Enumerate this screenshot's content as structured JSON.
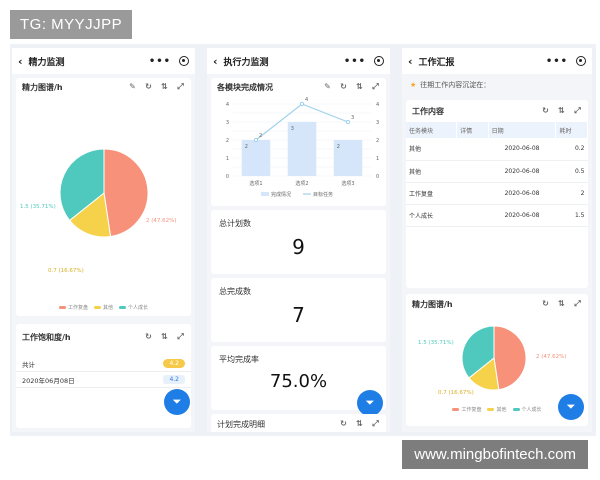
{
  "tg_badge": "TG: MYYJJPP",
  "watermark": "www.mingbofintech.com",
  "colors": {
    "accent": "#1e7ee6",
    "salmon": "#f7917a",
    "teal": "#4fc9bd",
    "yellow": "#f6d24b",
    "bar": "#d6e6fa",
    "line": "#9fd0ec"
  },
  "phone1": {
    "title": "精力监测",
    "card1": {
      "title": "精力图谱/h",
      "pie_labels": [
        "2 (47.62%)",
        "1.5 (35.71%)",
        "0.7 (16.67%)"
      ],
      "legend": [
        "工作复盘",
        "其他",
        "个人成长"
      ]
    },
    "card2": {
      "title": "工作饱和度/h",
      "rows": [
        {
          "label": "共计",
          "value": "4.2"
        },
        {
          "label": "2020年06月08日",
          "value": "4.2"
        }
      ]
    }
  },
  "phone2": {
    "title": "执行力监测",
    "chart_title": "各模块完成情况",
    "legend": [
      "完成情况",
      "目标任务"
    ],
    "kpis": [
      {
        "title": "总计划数",
        "value": "9"
      },
      {
        "title": "总完成数",
        "value": "7"
      },
      {
        "title": "平均完成率",
        "value": "75.0%"
      }
    ],
    "bottom_title": "计划完成明细"
  },
  "phone3": {
    "title": "工作汇报",
    "notice": "往期工作内容沉淀在：",
    "table_title": "工作内容",
    "columns": [
      "任务模块",
      "详情",
      "日期",
      "耗时"
    ],
    "rows": [
      [
        "其他",
        "",
        "2020-06-08",
        "0.2"
      ],
      [
        "其他",
        "",
        "2020-06-08",
        "0.5"
      ],
      [
        "工作复盘",
        "",
        "2020-06-08",
        "2"
      ],
      [
        "个人成长",
        "",
        "2020-06-08",
        "1.5"
      ]
    ],
    "card2": {
      "title": "精力图谱/h",
      "pie_labels": [
        "2 (47.62%)",
        "1.5 (35.71%)",
        "0.7 (16.67%)"
      ],
      "legend": [
        "工作复盘",
        "其他",
        "个人成长"
      ]
    }
  },
  "chart_data": [
    {
      "type": "pie",
      "title": "精力图谱/h",
      "categories": [
        "工作复盘",
        "个人成长",
        "其他"
      ],
      "values": [
        2,
        1.5,
        0.7
      ],
      "percentages": [
        47.62,
        35.71,
        16.67
      ],
      "legend_position": "bottom"
    },
    {
      "type": "bar",
      "title": "各模块完成情况",
      "categories": [
        "选项1",
        "选项2",
        "选项3"
      ],
      "series": [
        {
          "name": "完成情况",
          "type": "bar",
          "values": [
            2,
            3,
            2
          ]
        },
        {
          "name": "目标任务",
          "type": "line",
          "values": [
            2,
            4,
            3
          ]
        }
      ],
      "ylim": [
        0,
        4
      ],
      "legend_position": "bottom"
    },
    {
      "type": "pie",
      "title": "精力图谱/h",
      "categories": [
        "工作复盘",
        "个人成长",
        "其他"
      ],
      "values": [
        2,
        1.5,
        0.7
      ],
      "percentages": [
        47.62,
        35.71,
        16.67
      ],
      "legend_position": "bottom"
    }
  ]
}
